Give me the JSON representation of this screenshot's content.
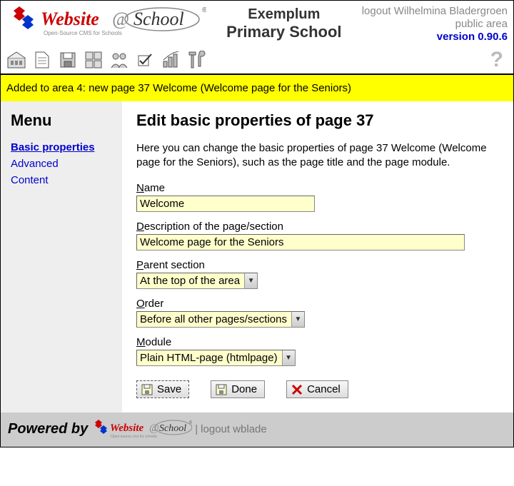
{
  "header": {
    "school_line1": "Exemplum",
    "school_line2": "Primary School",
    "logout_text": "logout Wilhelmina Bladergroen",
    "public_area": "public area",
    "version": "version 0.90.6"
  },
  "notice": "Added to area 4: new page 37 Welcome (Welcome page for the Seniors)",
  "sidebar": {
    "title": "Menu",
    "items": [
      {
        "label": "Basic properties",
        "active": true
      },
      {
        "label": "Advanced",
        "active": false
      },
      {
        "label": "Content",
        "active": false
      }
    ]
  },
  "main": {
    "title": "Edit basic properties of page 37",
    "intro": "Here you can change the basic properties of page 37 Welcome (Welcome page for the Seniors), such as the page title and the page module.",
    "fields": {
      "name": {
        "key": "N",
        "rest": "ame",
        "value": "Welcome"
      },
      "description": {
        "key": "D",
        "rest": "escription of the page/section",
        "value": "Welcome page for the Seniors"
      },
      "parent": {
        "key": "P",
        "rest": "arent section",
        "value": "At the top of the area"
      },
      "order": {
        "key": "O",
        "rest": "rder",
        "value": "Before all other pages/sections"
      },
      "module": {
        "key": "M",
        "rest": "odule",
        "value": "Plain HTML-page (htmlpage)"
      }
    },
    "buttons": {
      "save": "Save",
      "done": "Done",
      "cancel": "Cancel"
    }
  },
  "footer": {
    "powered": "Powered by",
    "logout": "logout wblade"
  }
}
